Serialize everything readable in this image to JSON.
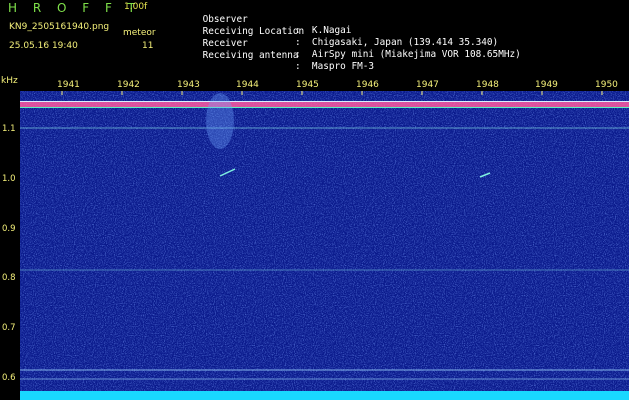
{
  "header": {
    "app_title": "H R O F F T",
    "version": "1.00f",
    "filename": "KN9_2505161940.png",
    "meteor_label": "meteor",
    "meteor_count": "11",
    "datetime": "25.05.16 19:40"
  },
  "info": [
    {
      "label": "Observer",
      "value": ":  K.Nagai"
    },
    {
      "label": "Receiving Location",
      "value": ":  Chigasaki, Japan (139.414 35.340)"
    },
    {
      "label": "Receiver",
      "value": ":  AirSpy mini (Miakejima VOR 108.65MHz)"
    },
    {
      "label": "Receiving antenna",
      "value": ":  Maspro FM-3"
    }
  ],
  "axis": {
    "y_unit": "kHz",
    "y_ticks": [
      "1.1",
      "1.0",
      "0.9",
      "0.8",
      "0.7",
      "0.6"
    ],
    "x_ticks": [
      "1941",
      "1942",
      "1943",
      "1944",
      "1945",
      "1946",
      "1947",
      "1948",
      "1949",
      "1950"
    ]
  },
  "colors": {
    "background": "#000000",
    "spectrogram": "#0a1a8c",
    "label_yellow": "#f4f07a",
    "title_green": "#7fe04a",
    "carrier_band": "#ff5aa0",
    "floor_cyan": "#19d8ff"
  }
}
